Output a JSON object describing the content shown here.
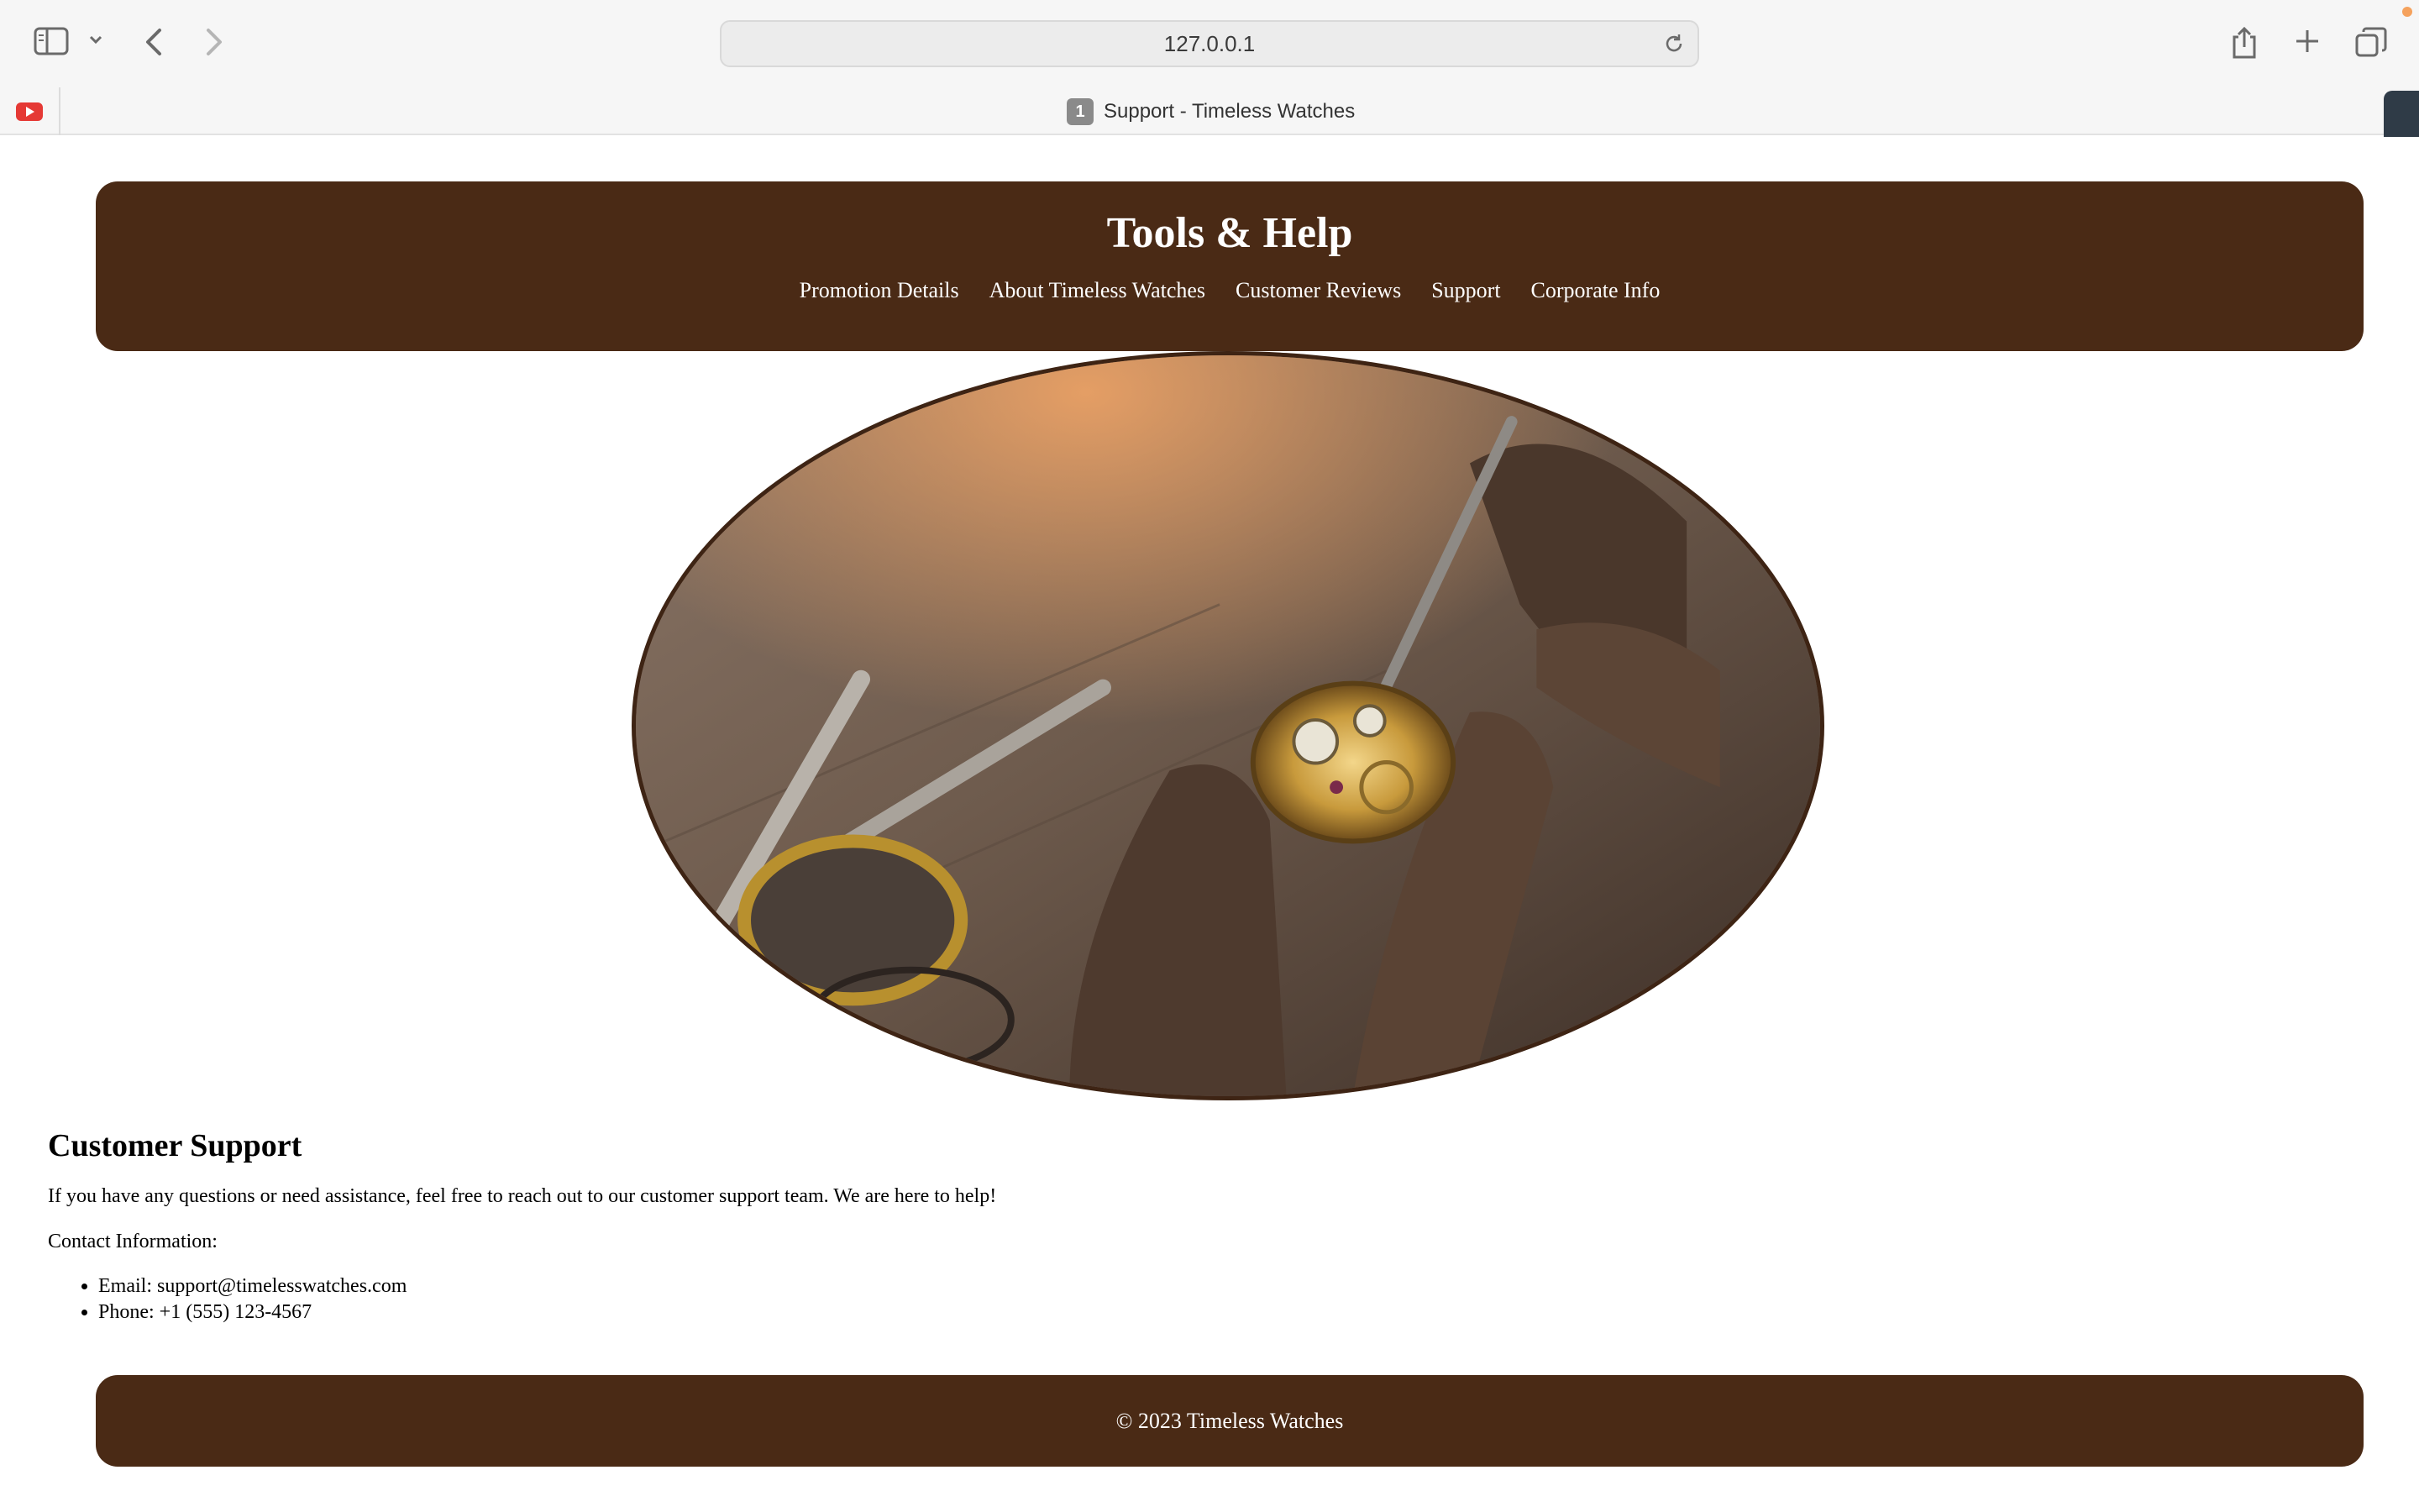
{
  "browser": {
    "address": "127.0.0.1",
    "tab": {
      "badge": "1",
      "title": "Support - Timeless Watches"
    },
    "icons": {
      "sidebar": "sidebar-icon",
      "chevron": "chevron-down-icon",
      "back": "back-arrow-icon",
      "forward": "forward-arrow-icon",
      "reload": "reload-icon",
      "share": "share-icon",
      "new_tab": "plus-icon",
      "tabs": "tabs-overview-icon",
      "pinned": "youtube-icon"
    }
  },
  "site": {
    "title": "Tools & Help",
    "nav": [
      {
        "label": "Promotion Details"
      },
      {
        "label": "About Timeless Watches"
      },
      {
        "label": "Customer Reviews"
      },
      {
        "label": "Support"
      },
      {
        "label": "Corporate Info"
      }
    ],
    "colors": {
      "header_bg": "#4a2a15",
      "header_text": "#ffffff"
    }
  },
  "support": {
    "heading": "Customer Support",
    "intro": "If you have any questions or need assistance, feel free to reach out to our customer support team. We are here to help!",
    "contact_label": "Contact Information:",
    "contacts": [
      {
        "text": "Email: support@timelesswatches.com"
      },
      {
        "text": "Phone: +1 (555) 123-4567"
      }
    ]
  },
  "footer": {
    "text": "© 2023 Timeless Watches"
  }
}
